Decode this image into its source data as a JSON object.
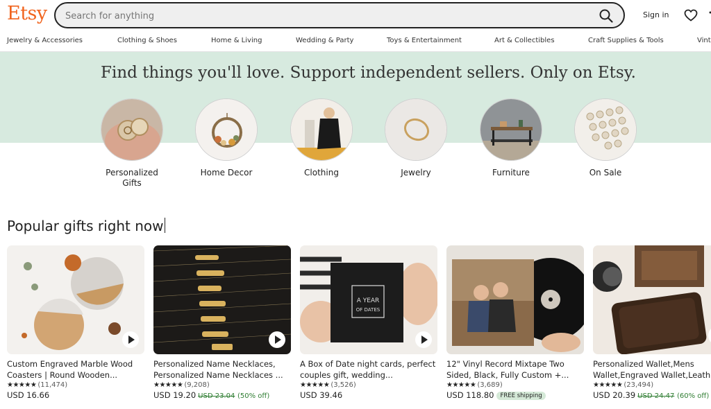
{
  "header": {
    "logo": "Etsy",
    "search_placeholder": "Search for anything",
    "search_icon": "search-icon",
    "sign_in": "Sign in",
    "favorites_icon": "heart-icon"
  },
  "categories_nav": [
    "Jewelry & Accessories",
    "Clothing & Shoes",
    "Home & Living",
    "Wedding & Party",
    "Toys & Entertainment",
    "Art & Collectibles",
    "Craft Supplies & Tools",
    "Vint"
  ],
  "hero": {
    "title": "Find things you'll love. Support independent sellers. Only on Etsy.",
    "categories": [
      {
        "label": "Personalized Gifts"
      },
      {
        "label": "Home Decor"
      },
      {
        "label": "Clothing"
      },
      {
        "label": "Jewelry"
      },
      {
        "label": "Furniture"
      },
      {
        "label": "On Sale"
      }
    ]
  },
  "popular": {
    "title": "Popular gifts right now",
    "items": [
      {
        "title": "Custom Engraved Marble Wood Coasters | Round Wooden...",
        "stars": "★★★★★",
        "count": "(11,474)",
        "price": "USD 16.66",
        "original_price": "",
        "discount": "",
        "shipping": "",
        "has_video": true
      },
      {
        "title": "Personalized Name Necklaces, Personalized Name Necklaces ...",
        "stars": "★★★★★",
        "count": "(9,208)",
        "price": "USD 19.20",
        "original_price": "USD 23.04",
        "discount": "(50% off)",
        "shipping": "",
        "has_video": true
      },
      {
        "title": "A Box of Date night cards, perfect couples gift, wedding...",
        "stars": "★★★★★",
        "count": "(3,526)",
        "price": "USD 39.46",
        "original_price": "",
        "discount": "",
        "shipping": "",
        "has_video": true
      },
      {
        "title": "12\" Vinyl Record Mixtape Two Sided, Black, Fully Custom +...",
        "stars": "★★★★★",
        "count": "(3,689)",
        "price": "USD 118.80",
        "original_price": "",
        "discount": "",
        "shipping": "FREE shipping",
        "has_video": false
      },
      {
        "title": "Personalized Wallet,Mens Wallet,Engraved Wallet,Leath",
        "stars": "★★★★★",
        "count": "(23,494)",
        "price": "USD 20.39",
        "original_price": "USD 24.47",
        "discount": "(60% off)",
        "shipping": "",
        "has_video": false
      }
    ]
  },
  "image_text": {
    "box_line1": "A YEAR",
    "box_line2": "OF DATES"
  },
  "colors": {
    "brand": "#f1641e",
    "hero_bg": "#d7eadf",
    "discount": "#2f7d32"
  }
}
